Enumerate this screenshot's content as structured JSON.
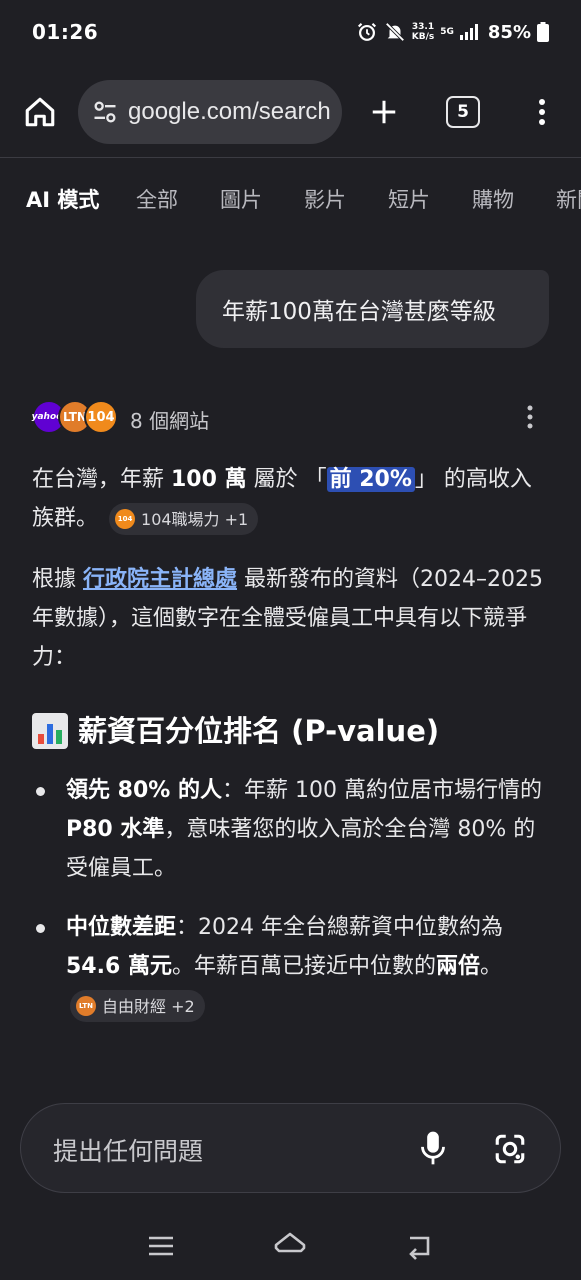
{
  "status_bar": {
    "time": "01:26",
    "net_speed": "33.1",
    "net_unit": "KB/s",
    "network": "5G",
    "battery": "85%",
    "icons": [
      "alarm-icon",
      "mute-icon",
      "signal-icon",
      "battery-icon"
    ]
  },
  "browser": {
    "url": "google.com/search",
    "tab_count": "5",
    "icons": [
      "home-icon",
      "site-settings-icon",
      "new-tab-icon",
      "more-vert-icon"
    ]
  },
  "search_tabs": [
    {
      "label": "AI 模式",
      "active": true
    },
    {
      "label": "全部",
      "active": false
    },
    {
      "label": "圖片",
      "active": false
    },
    {
      "label": "影片",
      "active": false
    },
    {
      "label": "短片",
      "active": false
    },
    {
      "label": "購物",
      "active": false
    },
    {
      "label": "新聞",
      "active": false
    }
  ],
  "query": "年薪100萬在台灣甚麼等級",
  "sources": {
    "count_label": "8 個網站",
    "logos": [
      "yahoo!",
      "LTN",
      "104"
    ]
  },
  "answer": {
    "p1_a": "在台灣，年薪 ",
    "p1_b": "100 萬",
    "p1_c": " 屬於 「",
    "p1_hl": "前 20%",
    "p1_d": "」 的高收入族群。",
    "chip1_logo": "104",
    "chip1_label": "104職場力 +1",
    "p2_a": "根據 ",
    "p2_link": "行政院主計總處",
    "p2_b": " 最新發布的資料（2024–2025 年數據），這個數字在全體受僱員工中具有以下競爭力：",
    "heading": "薪資百分位排名 (P-value)",
    "b1_bold": "領先 80% 的人",
    "b1_a": "：年薪 100 萬約位居市場行情的 ",
    "b1_bold2": "P80 水準",
    "b1_b": "，意味著您的收入高於全台灣 80% 的受僱員工。",
    "b2_bold": "中位數差距",
    "b2_a": "：2024 年全台總薪資中位數約為 ",
    "b2_bold2": "54.6 萬元",
    "b2_b": "。年薪百萬已接近中位數的",
    "b2_bold3": "兩倍",
    "b2_c": "。",
    "chip2_logo": "LTN",
    "chip2_label": "自由財經 +2"
  },
  "ask_box": {
    "placeholder": "提出任何問題",
    "icons": [
      "mic-icon",
      "lens-icon"
    ]
  },
  "nav_bar": {
    "icons": [
      "recent-apps-icon",
      "home-nav-icon",
      "back-icon"
    ]
  }
}
